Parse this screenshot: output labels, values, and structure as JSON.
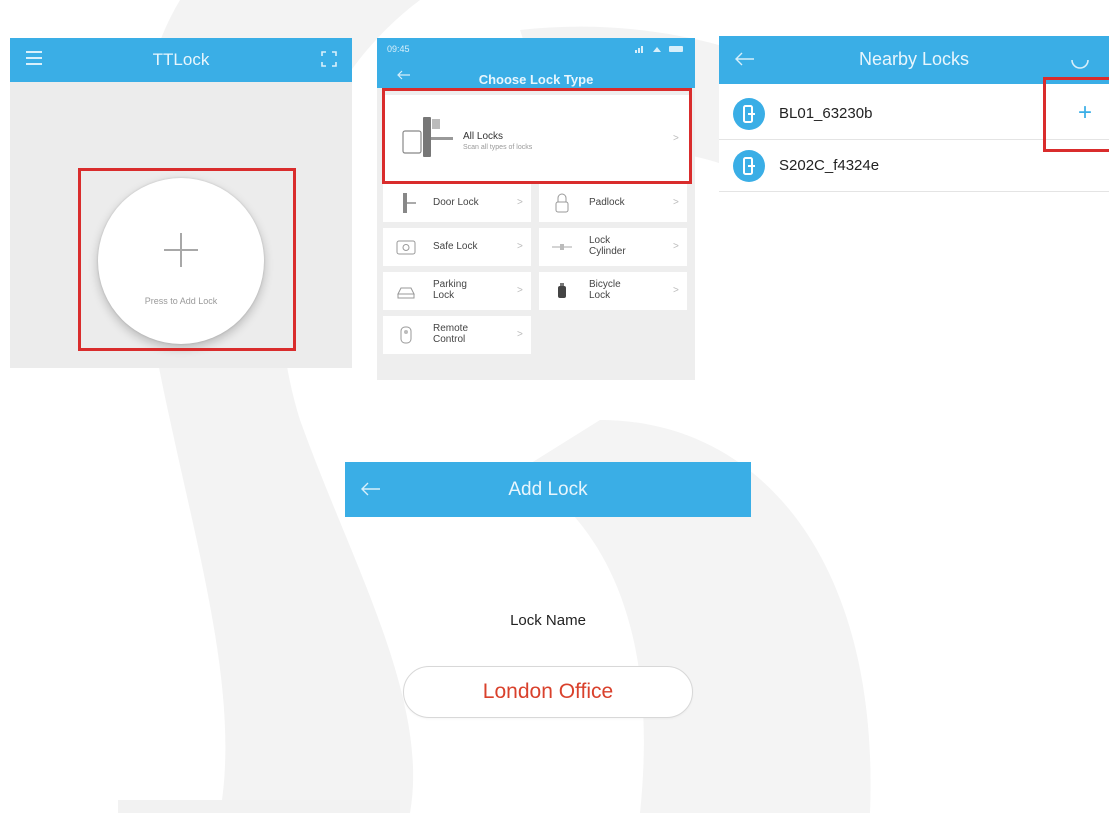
{
  "panel1": {
    "title": "TTLock",
    "add_lock_label": "Press to Add Lock",
    "icons": [
      "menu-icon",
      "scan-icon",
      "plus-icon"
    ]
  },
  "panel2": {
    "status_time": "09:45",
    "title": "Choose Lock Type",
    "all_locks": {
      "label": "All Locks",
      "sublabel": "Scan all types of locks"
    },
    "types": [
      {
        "label": "Door Lock"
      },
      {
        "label": "Padlock"
      },
      {
        "label": "Safe Lock"
      },
      {
        "label": "Lock Cylinder"
      },
      {
        "label": "Parking Lock"
      },
      {
        "label": "Bicycle Lock"
      },
      {
        "label": "Remote Control"
      }
    ],
    "chevron": ">"
  },
  "panel3": {
    "title": "Nearby Locks",
    "locks": [
      {
        "name": "BL01_63230b"
      },
      {
        "name": "S202C_f4324e"
      }
    ],
    "add_symbol": "+"
  },
  "panel4": {
    "title": "Add Lock",
    "field_label": "Lock Name",
    "field_value": "London Office"
  },
  "colors": {
    "accent": "#3aaee6",
    "highlight": "#d92c2c",
    "input_text": "#d9412c"
  }
}
